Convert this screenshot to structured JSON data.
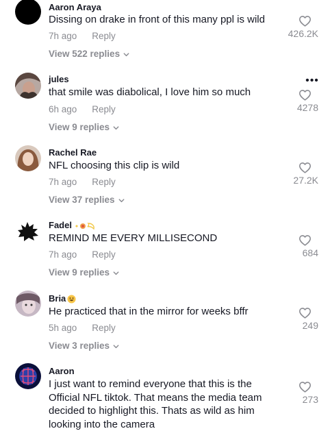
{
  "comments": [
    {
      "username": "Aaron Araya",
      "text": "Dissing on drake in front of this many ppl is wild",
      "time": "7h ago",
      "reply": "Reply",
      "replies": "View 522 replies",
      "likes": "426.2K"
    },
    {
      "username": "jules",
      "text": "that smile was diabolical, I love him so much",
      "time": "6h ago",
      "reply": "Reply",
      "replies": "View 9 replies",
      "likes": "4278"
    },
    {
      "username": "Rachel Rae",
      "text": "NFL choosing this clip is wild",
      "time": "7h ago",
      "reply": "Reply",
      "replies": "View 37 replies",
      "likes": "27.2K"
    },
    {
      "username": "Fadel",
      "text": "REMIND ME EVERY MILLISECOND",
      "time": "7h ago",
      "reply": "Reply",
      "replies": "View 9 replies",
      "likes": "684"
    },
    {
      "username": "Bria",
      "text": "He practiced that in the mirror for weeks bffr",
      "time": "5h ago",
      "reply": "Reply",
      "replies": "View 3 replies",
      "likes": "249"
    },
    {
      "username": "Aaron",
      "text": "I just want to remind everyone that this is the Official NFL tiktok. That means the media team decided to highlight this. Thats as wild as him looking into the camera",
      "likes": "273"
    }
  ],
  "colors": {
    "text": "#161823",
    "secondary": "#8a8b91",
    "background": "#ffffff"
  },
  "icons": {
    "like": "heart-outline-icon",
    "more": "more-dots-icon",
    "chevron": "chevron-down-icon"
  }
}
